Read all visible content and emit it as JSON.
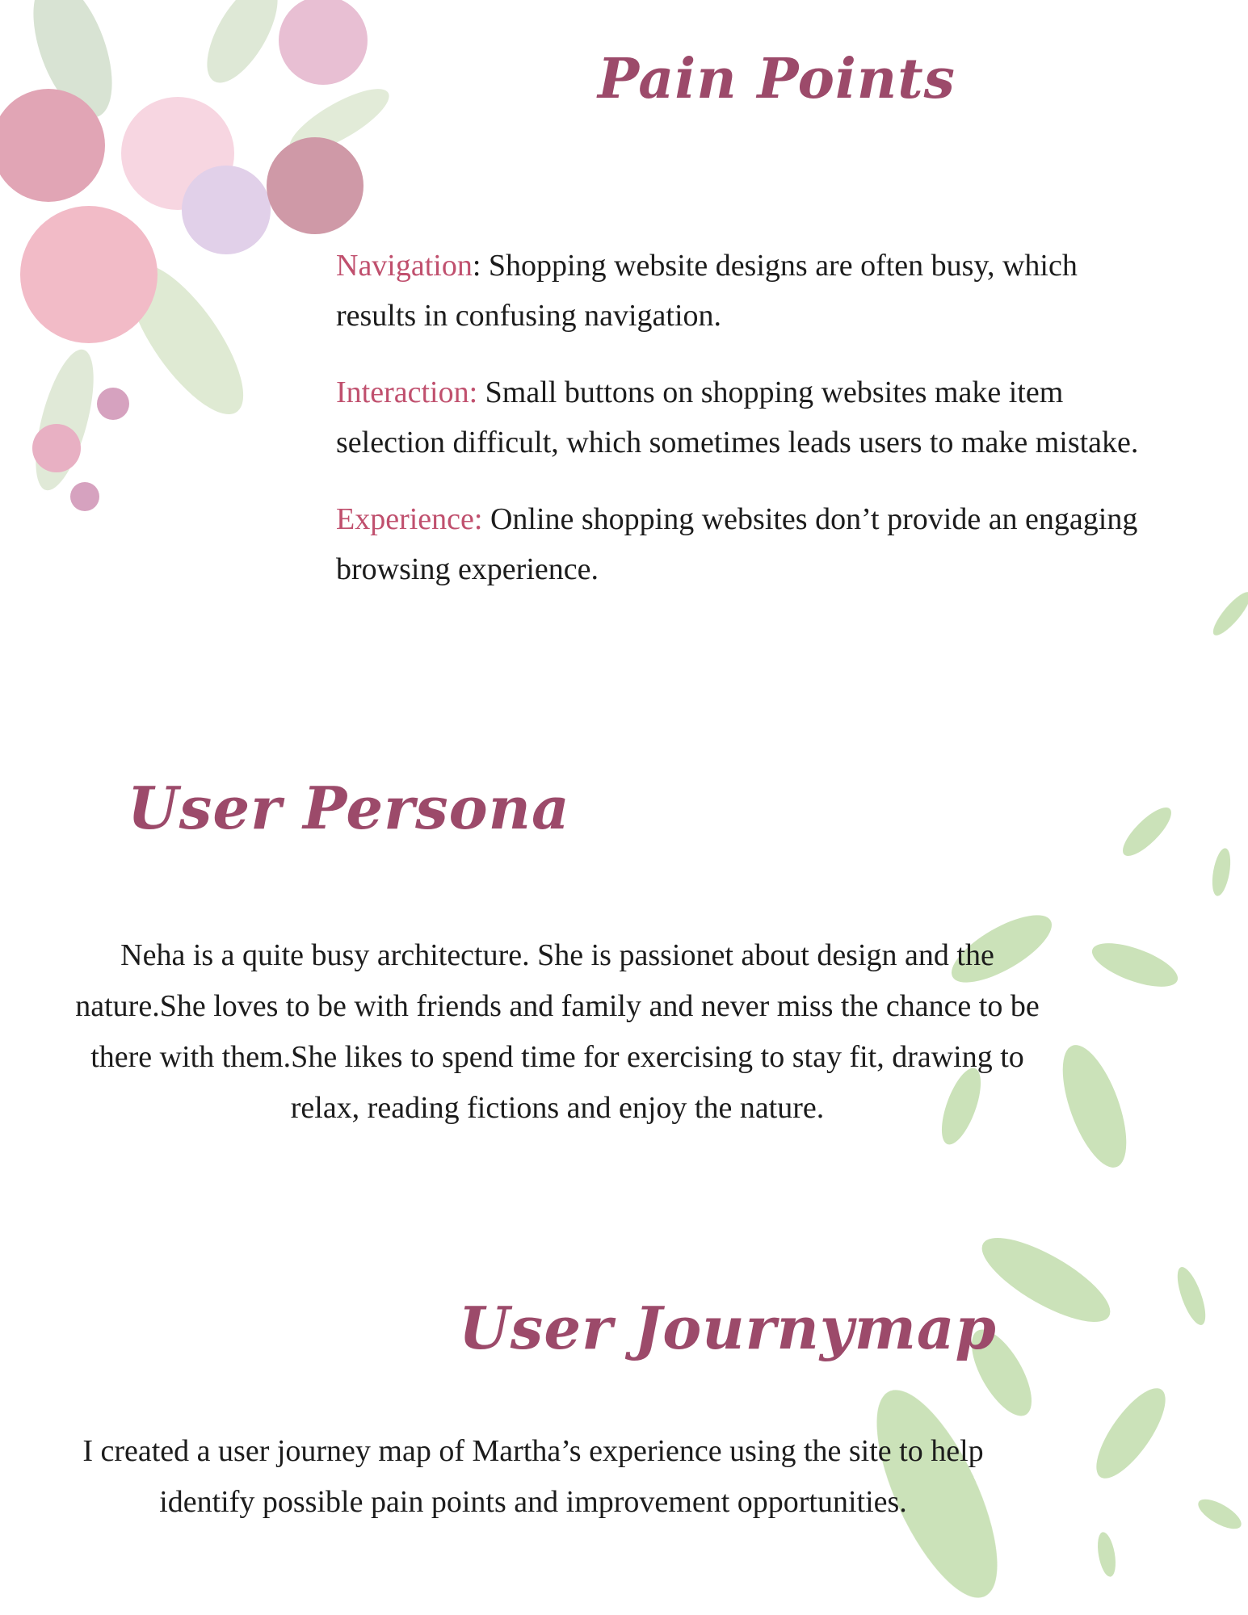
{
  "pain_points": {
    "title": "Pain Points",
    "items": [
      {
        "term": "Navigation",
        "separator": ":",
        "text": " Shopping website designs are often busy, which results in confusing navigation."
      },
      {
        "term": "Interaction:",
        "separator": "",
        "text": " Small buttons on shopping websites make item selection difficult, which sometimes leads users to make mistake."
      },
      {
        "term": "Experience:",
        "separator": "",
        "text": " Online shopping websites don’t provide an engaging browsing experience."
      }
    ]
  },
  "user_persona": {
    "title": "User Persona",
    "text": "Neha is a quite busy architecture. She is passionet about design and the nature.She loves to be with friends and family and never miss the chance to be there with them.She likes to spend time for exercising to stay fit, drawing to relax, reading fictions and enjoy the nature."
  },
  "user_journeymap": {
    "title": "User Journymap",
    "text": "I created a user journey map of Martha’s experience using the site to help identify possible pain points and improvement opportunities."
  },
  "colors": {
    "heading": "#9c4a6a",
    "term": "#c0506e",
    "body": "#1c1c1c",
    "leaf": "#a9cf8a",
    "flower": "#d9869e"
  }
}
